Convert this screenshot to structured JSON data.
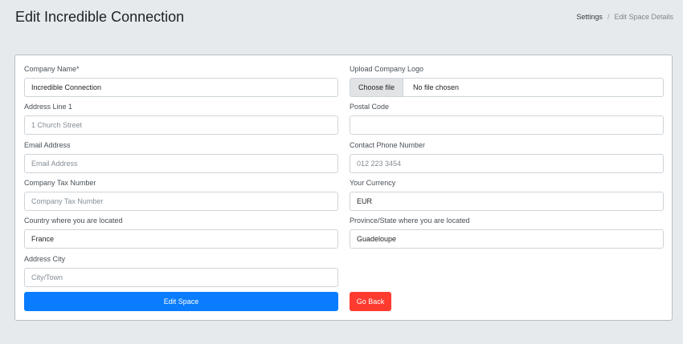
{
  "header": {
    "title": "Edit Incredible Connection",
    "breadcrumb": {
      "link": "Settings",
      "separator": "/",
      "current": "Edit Space Details"
    }
  },
  "form": {
    "company_name": {
      "label": "Company Name*",
      "value": "Incredible Connection",
      "placeholder": ""
    },
    "upload_logo": {
      "label": "Upload Company Logo",
      "button": "Choose file",
      "status": "No file chosen"
    },
    "address_line1": {
      "label": "Address Line 1",
      "value": "",
      "placeholder": "1 Church Street"
    },
    "postal_code": {
      "label": "Postal Code",
      "value": "",
      "placeholder": ""
    },
    "email": {
      "label": "Email Address",
      "value": "",
      "placeholder": "Email Address"
    },
    "phone": {
      "label": "Contact Phone Number",
      "value": "",
      "placeholder": "012 223 3454"
    },
    "tax_number": {
      "label": "Company Tax Number",
      "value": "",
      "placeholder": "Company Tax Number"
    },
    "currency": {
      "label": "Your Currency",
      "value": "EUR"
    },
    "country": {
      "label": "Country where you are located",
      "value": "France"
    },
    "province": {
      "label": "Province/State where you are located",
      "value": "Guadeloupe"
    },
    "city": {
      "label": "Address City",
      "value": "",
      "placeholder": "City/Town"
    }
  },
  "actions": {
    "submit_label": "Edit Space",
    "back_label": "Go Back"
  },
  "colors": {
    "primary": "#0a7cff",
    "danger": "#ff3b30",
    "background": "#e7eaec"
  }
}
